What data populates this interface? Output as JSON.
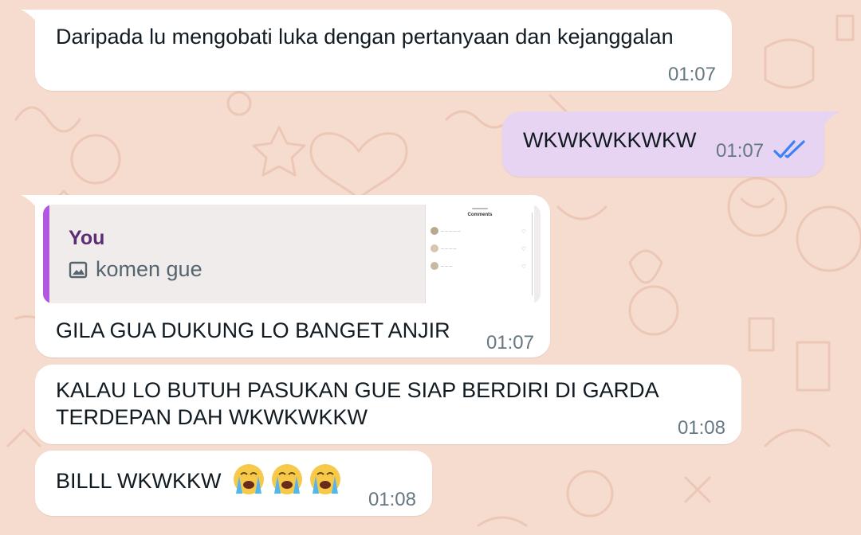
{
  "messages": [
    {
      "direction": "incoming",
      "text": "Daripada lu mengobati luka dengan pertanyaan dan kejanggalan",
      "time": "01:07"
    },
    {
      "direction": "outgoing",
      "text": "WKWKWKKWKW",
      "time": "01:07",
      "status_icon": "double-check-read-icon"
    },
    {
      "direction": "incoming",
      "reply_quote": {
        "author": "You",
        "media_icon": "image-icon",
        "text": "komen gue",
        "thumbnail_icon": "comments-screenshot-thumbnail"
      },
      "text": "GILA GUA DUKUNG LO BANGET ANJIR",
      "time": "01:07"
    },
    {
      "direction": "incoming",
      "text_lines": [
        "KALAU LO BUTUH PASUKAN GUE SIAP BERDIRI DI GARDA",
        "TERDEPAN DAH WKWKWKKW"
      ],
      "time": "01:08"
    },
    {
      "direction": "incoming",
      "text": "BILLL WKWKKW",
      "emojis": [
        "loudly-crying-face",
        "loudly-crying-face",
        "loudly-crying-face"
      ],
      "time": "01:08"
    }
  ],
  "colors": {
    "wallpaper": "#f6dccf",
    "incoming_bubble": "#ffffff",
    "outgoing_bubble": "#e7d4f3",
    "quote_bar": "#b158e0",
    "read_ticks": "#3b82f6"
  }
}
